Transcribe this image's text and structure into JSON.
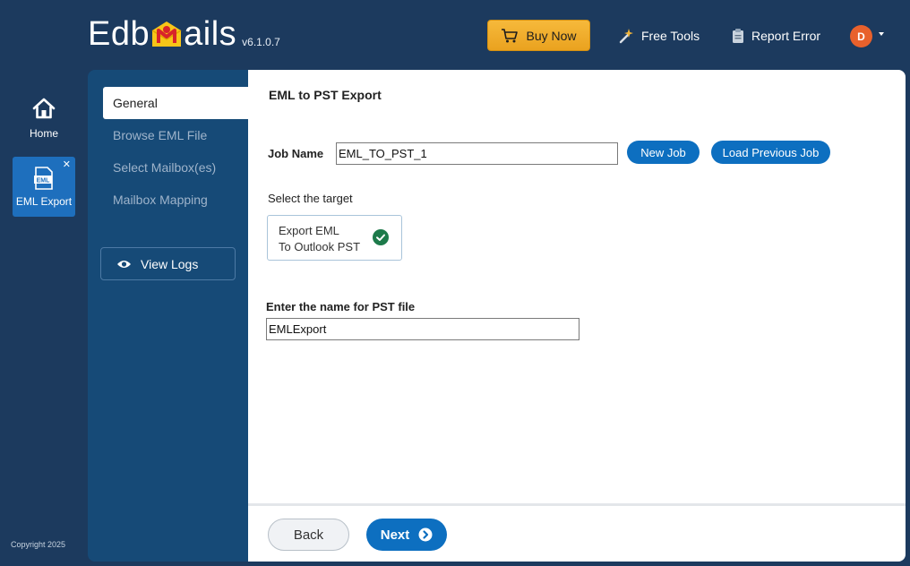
{
  "header": {
    "logo_left": "Edb",
    "logo_right": "ails",
    "version": "v6.1.0.7",
    "buy_now_label": "Buy Now",
    "free_tools_label": "Free Tools",
    "report_error_label": "Report Error",
    "avatar_initial": "D"
  },
  "rail": {
    "home_label": "Home",
    "eml_export_label": "EML Export",
    "close_glyph": "✕",
    "copyright": "Copyright 2025"
  },
  "nav": {
    "items": [
      {
        "label": "General"
      },
      {
        "label": "Browse EML File"
      },
      {
        "label": "Select Mailbox(es)"
      },
      {
        "label": "Mailbox Mapping"
      }
    ],
    "view_logs_label": "View Logs"
  },
  "main": {
    "title": "EML to PST Export",
    "job_name_label": "Job Name",
    "job_name_value": "EML_TO_PST_1",
    "new_job_label": "New Job",
    "load_previous_job_label": "Load Previous Job",
    "select_target_label": "Select the target",
    "target_card": {
      "line1": "Export EML",
      "line2": "To Outlook PST",
      "selected": true
    },
    "pst_name_label": "Enter the name for PST file",
    "pst_name_value": "EMLExport"
  },
  "footer": {
    "back_label": "Back",
    "next_label": "Next"
  },
  "colors": {
    "app_background": "#1c3a5e",
    "nav_panel": "#164a77",
    "accent_blue": "#0d6fc0",
    "buy_now": "#f6b93b",
    "avatar": "#e8612c",
    "check_green": "#1d7a4a"
  }
}
